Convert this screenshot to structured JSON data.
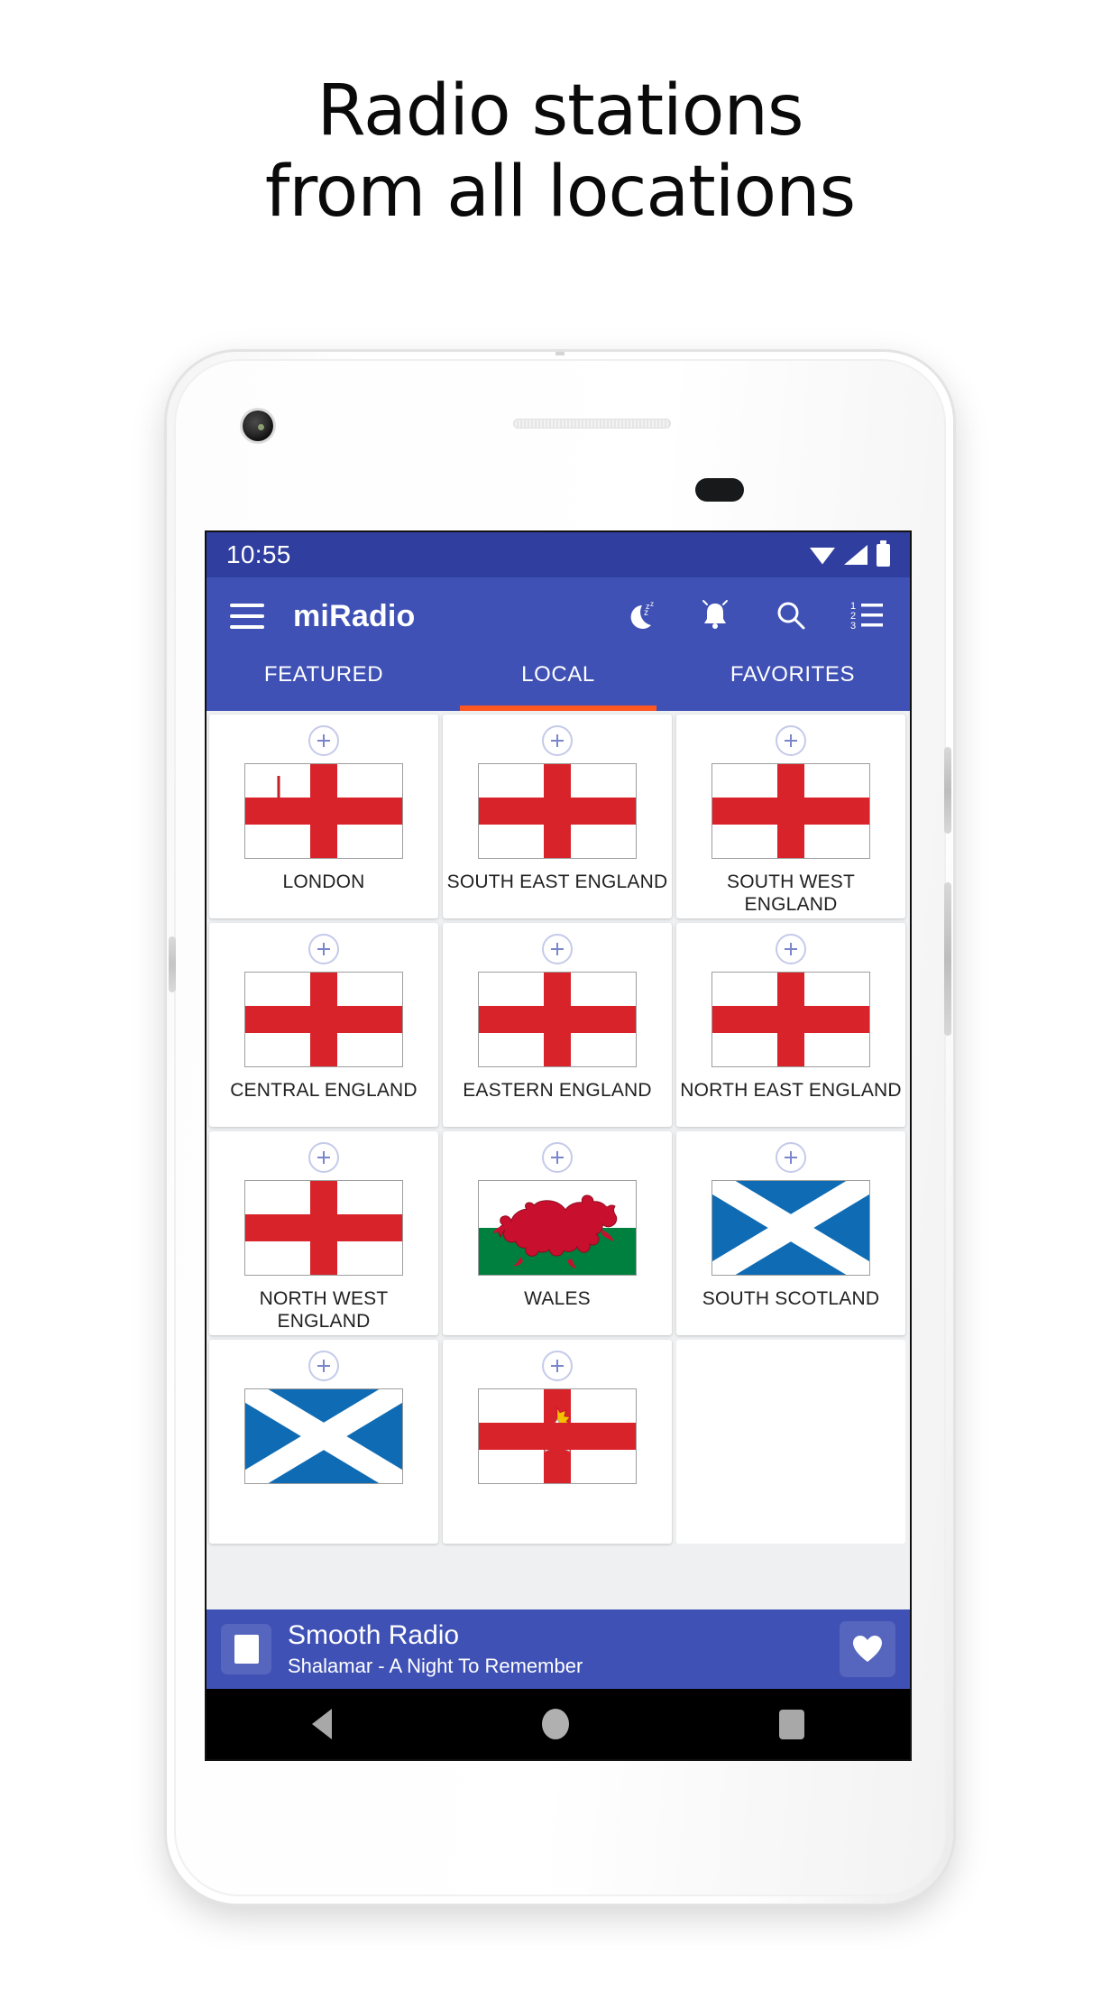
{
  "headline": {
    "line1": "Radio stations",
    "line2": "from all locations"
  },
  "status_bar": {
    "time": "10:55",
    "icons": [
      "wifi-icon",
      "cellular-signal-icon",
      "battery-icon"
    ]
  },
  "appbar": {
    "menu_icon": "hamburger-menu-icon",
    "title": "miRadio",
    "actions": [
      {
        "name": "sleep-timer-icon",
        "label": "Sleep timer"
      },
      {
        "name": "alarm-bell-icon",
        "label": "Alarm"
      },
      {
        "name": "search-icon",
        "label": "Search"
      },
      {
        "name": "numbered-list-icon",
        "label": "Sorted list"
      }
    ]
  },
  "tabs": {
    "items": [
      {
        "label": "FEATURED",
        "active": false
      },
      {
        "label": "LOCAL",
        "active": true
      },
      {
        "label": "FAVORITES",
        "active": false
      }
    ],
    "indicator_color": "#ff5722"
  },
  "grid": {
    "add_icon": "plus-circle-icon",
    "cells": [
      {
        "label": "LONDON",
        "flag": "london"
      },
      {
        "label": "SOUTH EAST ENGLAND",
        "flag": "england"
      },
      {
        "label": "SOUTH WEST ENGLAND",
        "flag": "england"
      },
      {
        "label": "CENTRAL ENGLAND",
        "flag": "england"
      },
      {
        "label": "EASTERN ENGLAND",
        "flag": "england"
      },
      {
        "label": "NORTH EAST ENGLAND",
        "flag": "england"
      },
      {
        "label": "NORTH WEST ENGLAND",
        "flag": "england"
      },
      {
        "label": "WALES",
        "flag": "wales"
      },
      {
        "label": "SOUTH SCOTLAND",
        "flag": "scotland"
      },
      {
        "label": "",
        "flag": "scotland"
      },
      {
        "label": "",
        "flag": "northern-ireland"
      },
      {
        "label": "",
        "flag": "none"
      }
    ]
  },
  "now_playing": {
    "station": "Smooth Radio",
    "track": "Shalamar - A Night To Remember",
    "stop_icon": "stop-button-icon",
    "favorite_icon": "heart-icon"
  },
  "nav_bar": {
    "back": "back-triangle-icon",
    "home": "home-circle-icon",
    "recents": "recents-square-icon"
  },
  "colors": {
    "status_bar": "#303f9f",
    "app_bar": "#3f51b5",
    "accent": "#ff5722",
    "flag_red": "#d8232a",
    "scotland_blue": "#0f6cb4",
    "wales_green": "#00803e",
    "page_bg": "#ffffff",
    "grid_bg": "#eef0f1"
  }
}
